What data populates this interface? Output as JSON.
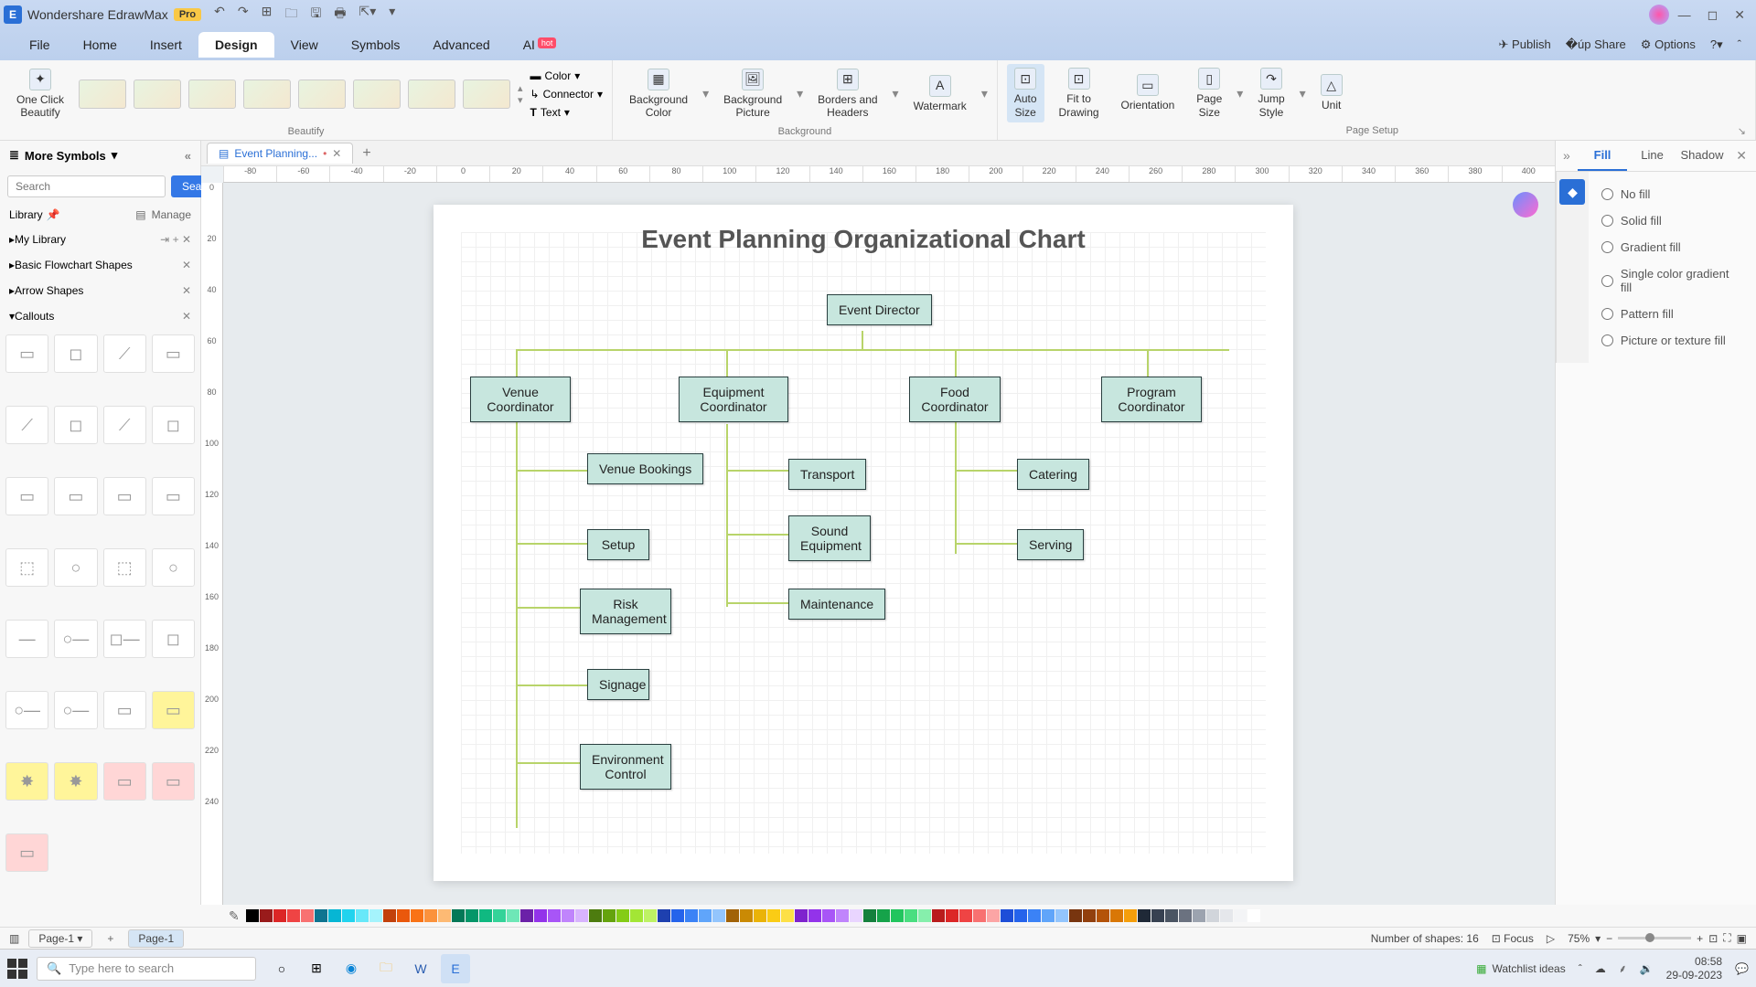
{
  "app": {
    "title": "Wondershare EdrawMax",
    "pro": "Pro"
  },
  "menus": {
    "file": "File",
    "home": "Home",
    "insert": "Insert",
    "design": "Design",
    "view": "View",
    "symbols": "Symbols",
    "advanced": "Advanced",
    "ai": "AI",
    "hot": "hot"
  },
  "topright": {
    "publish": "Publish",
    "share": "Share",
    "options": "Options"
  },
  "ribbon": {
    "oneclick": "One Click\nBeautify",
    "color": "Color",
    "connector": "Connector",
    "text": "Text",
    "bgcolor": "Background\nColor",
    "bgpic": "Background\nPicture",
    "borders": "Borders and\nHeaders",
    "watermark": "Watermark",
    "autosize": "Auto\nSize",
    "fit": "Fit to\nDrawing",
    "orientation": "Orientation",
    "pagesize": "Page\nSize",
    "jump": "Jump\nStyle",
    "unit": "Unit",
    "grp_beautify": "Beautify",
    "grp_bg": "Background",
    "grp_page": "Page Setup"
  },
  "left": {
    "more": "More Symbols",
    "search_ph": "Search",
    "search_btn": "Search",
    "library": "Library",
    "manage": "Manage",
    "mylib": "My Library",
    "cat1": "Basic Flowchart Shapes",
    "cat2": "Arrow Shapes",
    "cat3": "Callouts"
  },
  "doc": {
    "tab": "Event Planning...",
    "page1": "Page-1"
  },
  "rpanel": {
    "fill": "Fill",
    "line": "Line",
    "shadow": "Shadow",
    "nofill": "No fill",
    "solid": "Solid fill",
    "gradient": "Gradient fill",
    "single": "Single color gradient fill",
    "pattern": "Pattern fill",
    "picture": "Picture or texture fill"
  },
  "status": {
    "shapes": "Number of shapes: 16",
    "focus": "Focus",
    "zoom": "75%"
  },
  "taskbar": {
    "search": "Type here to search",
    "watchlist": "Watchlist ideas",
    "time": "08:58",
    "date": "29-09-2023"
  },
  "chart_data": {
    "type": "org-chart",
    "title": "Event Planning Organizational Chart",
    "root": "Event Director",
    "children": [
      {
        "name": "Venue Coordinator",
        "children": [
          "Venue Bookings",
          "Setup",
          "Risk Management",
          "Signage",
          "Environment Control"
        ]
      },
      {
        "name": "Equipment Coordinator",
        "children": [
          "Transport",
          "Sound Equipment",
          "Maintenance"
        ]
      },
      {
        "name": "Food Coordinator",
        "children": [
          "Catering",
          "Serving"
        ]
      },
      {
        "name": "Program Coordinator",
        "children": []
      }
    ]
  },
  "palette": [
    "#000000",
    "#991b1b",
    "#dc2626",
    "#ef4444",
    "#f87171",
    "#0e7490",
    "#06b6d4",
    "#22d3ee",
    "#67e8f9",
    "#a5f3fc",
    "#c2410c",
    "#ea580c",
    "#f97316",
    "#fb923c",
    "#fdba74",
    "#047857",
    "#059669",
    "#10b981",
    "#34d399",
    "#6ee7b7",
    "#6b21a8",
    "#9333ea",
    "#a855f7",
    "#c084fc",
    "#d8b4fe",
    "#4d7c0f",
    "#65a30d",
    "#84cc16",
    "#a3e635",
    "#bef264",
    "#1e40af",
    "#2563eb",
    "#3b82f6",
    "#60a5fa",
    "#93c5fd",
    "#a16207",
    "#ca8a04",
    "#eab308",
    "#facc15",
    "#fde047",
    "#7e22ce",
    "#9333ea",
    "#a855f7",
    "#c084fc",
    "#e9d5ff",
    "#15803d",
    "#16a34a",
    "#22c55e",
    "#4ade80",
    "#86efac",
    "#b91c1c",
    "#dc2626",
    "#ef4444",
    "#f87171",
    "#fca5a5",
    "#1d4ed8",
    "#2563eb",
    "#3b82f6",
    "#60a5fa",
    "#93c5fd",
    "#78350f",
    "#92400e",
    "#b45309",
    "#d97706",
    "#f59e0b",
    "#1f2937",
    "#374151",
    "#4b5563",
    "#6b7280",
    "#9ca3af",
    "#d1d5db",
    "#e5e7eb",
    "#f3f4f6",
    "#ffffff"
  ]
}
